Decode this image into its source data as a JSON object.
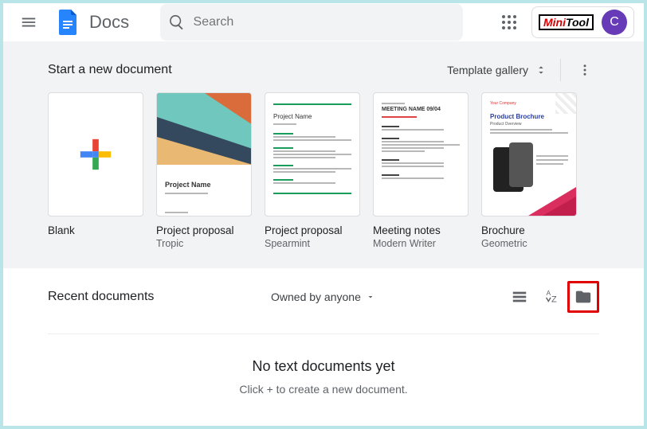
{
  "header": {
    "app_name": "Docs",
    "search_placeholder": "Search",
    "avatar_initial": "C",
    "brand_name": "MiniTool"
  },
  "templates": {
    "section_title": "Start a new document",
    "gallery_label": "Template gallery",
    "cards": [
      {
        "title": "Blank",
        "subtitle": ""
      },
      {
        "title": "Project proposal",
        "subtitle": "Tropic"
      },
      {
        "title": "Project proposal",
        "subtitle": "Spearmint"
      },
      {
        "title": "Meeting notes",
        "subtitle": "Modern Writer"
      },
      {
        "title": "Brochure",
        "subtitle": "Geometric"
      }
    ],
    "preview": {
      "tropic_caption": "Project Name",
      "spearmint_caption": "Project Name",
      "meeting_heading": "MEETING NAME 09/04",
      "brochure_heading": "Product Brochure",
      "brochure_company": "Your Company",
      "brochure_sub": "Product Overview"
    }
  },
  "recent": {
    "title": "Recent documents",
    "owner_filter": "Owned by anyone"
  },
  "empty_state": {
    "title": "No text documents yet",
    "subtitle": "Click + to create a new document."
  }
}
